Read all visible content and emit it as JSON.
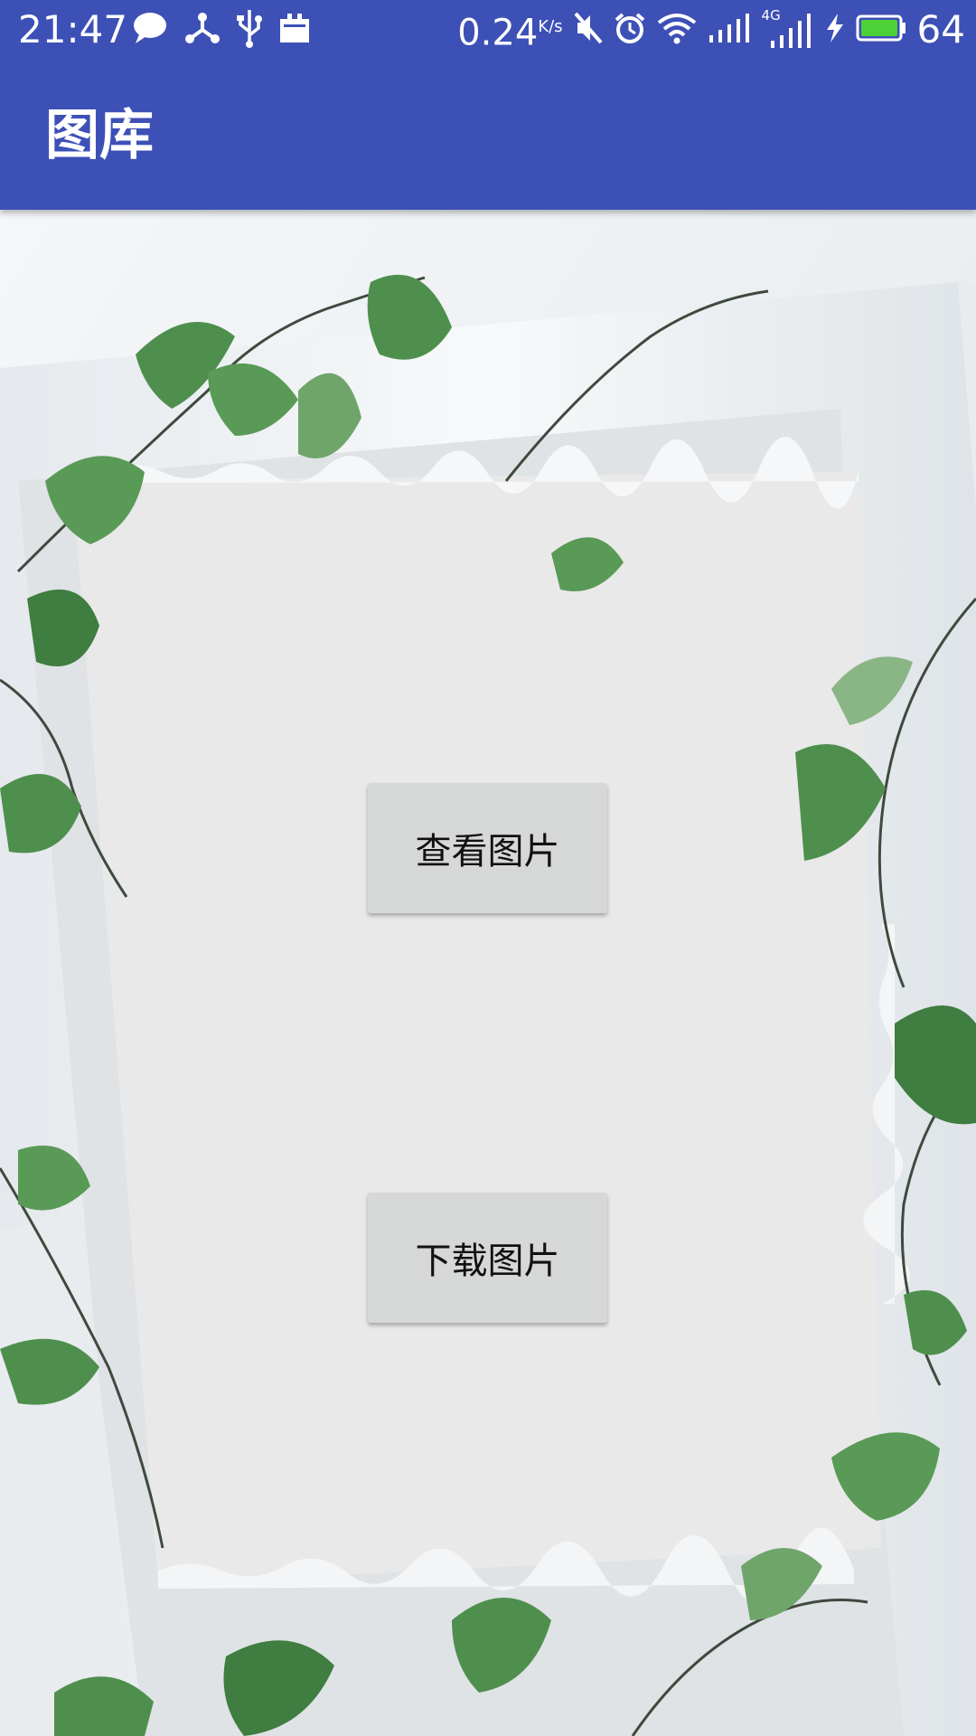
{
  "status_bar": {
    "time": "21:47",
    "net_speed": "0.24",
    "net_speed_unit": "K/s",
    "battery_percent": "64",
    "left_icons": [
      "chat-icon",
      "usb-debug-icon",
      "usb-icon",
      "storage-icon"
    ],
    "right_icons": [
      "mute-icon",
      "alarm-icon",
      "wifi-icon",
      "signal-icon",
      "signal-4g-icon",
      "charging-icon",
      "battery-icon"
    ],
    "signal_label": "4G"
  },
  "app_bar": {
    "title": "图库"
  },
  "buttons": {
    "view_label": "查看图片",
    "download_label": "下载图片"
  },
  "colors": {
    "primary": "#3D50B6",
    "button_bg": "#D6D7D7",
    "battery_fill": "#4CD137",
    "leaf": "#4F8F4E"
  },
  "background": {
    "description_icon": "ivy-frame-background"
  }
}
